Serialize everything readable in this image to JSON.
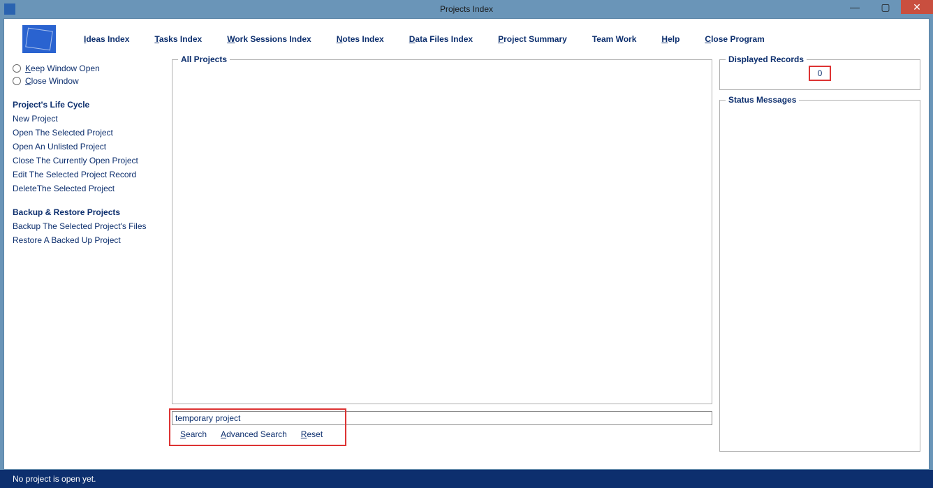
{
  "window": {
    "title": "Projects Index"
  },
  "menu": {
    "ideas": "Ideas Index",
    "tasks": "Tasks Index",
    "work": "Work Sessions Index",
    "notes": "Notes Index",
    "data": "Data Files Index",
    "summary": "Project Summary",
    "team": "Team Work",
    "help": "Help",
    "close": "Close Program"
  },
  "sidebar": {
    "keep_open": "Keep Window Open",
    "close_window": "Close Window",
    "lifecycle_head": "Project's Life Cycle",
    "lifecycle": [
      "New Project",
      "Open The Selected Project",
      "Open An Unlisted Project",
      "Close The Currently Open Project",
      "Edit The Selected Project Record",
      "DeleteThe Selected Project"
    ],
    "backup_head": "Backup & Restore Projects",
    "backup": [
      "Backup The Selected Project's Files",
      "Restore A Backed Up Project"
    ]
  },
  "center": {
    "all_projects_label": "All Projects",
    "search_value": "temporary project",
    "search_btn": "Search",
    "adv_search_btn": "Advanced Search",
    "reset_btn": "Reset"
  },
  "right": {
    "displayed_label": "Displayed Records",
    "displayed_value": "0",
    "status_label": "Status Messages"
  },
  "statusbar": {
    "text": "No project is open yet."
  }
}
